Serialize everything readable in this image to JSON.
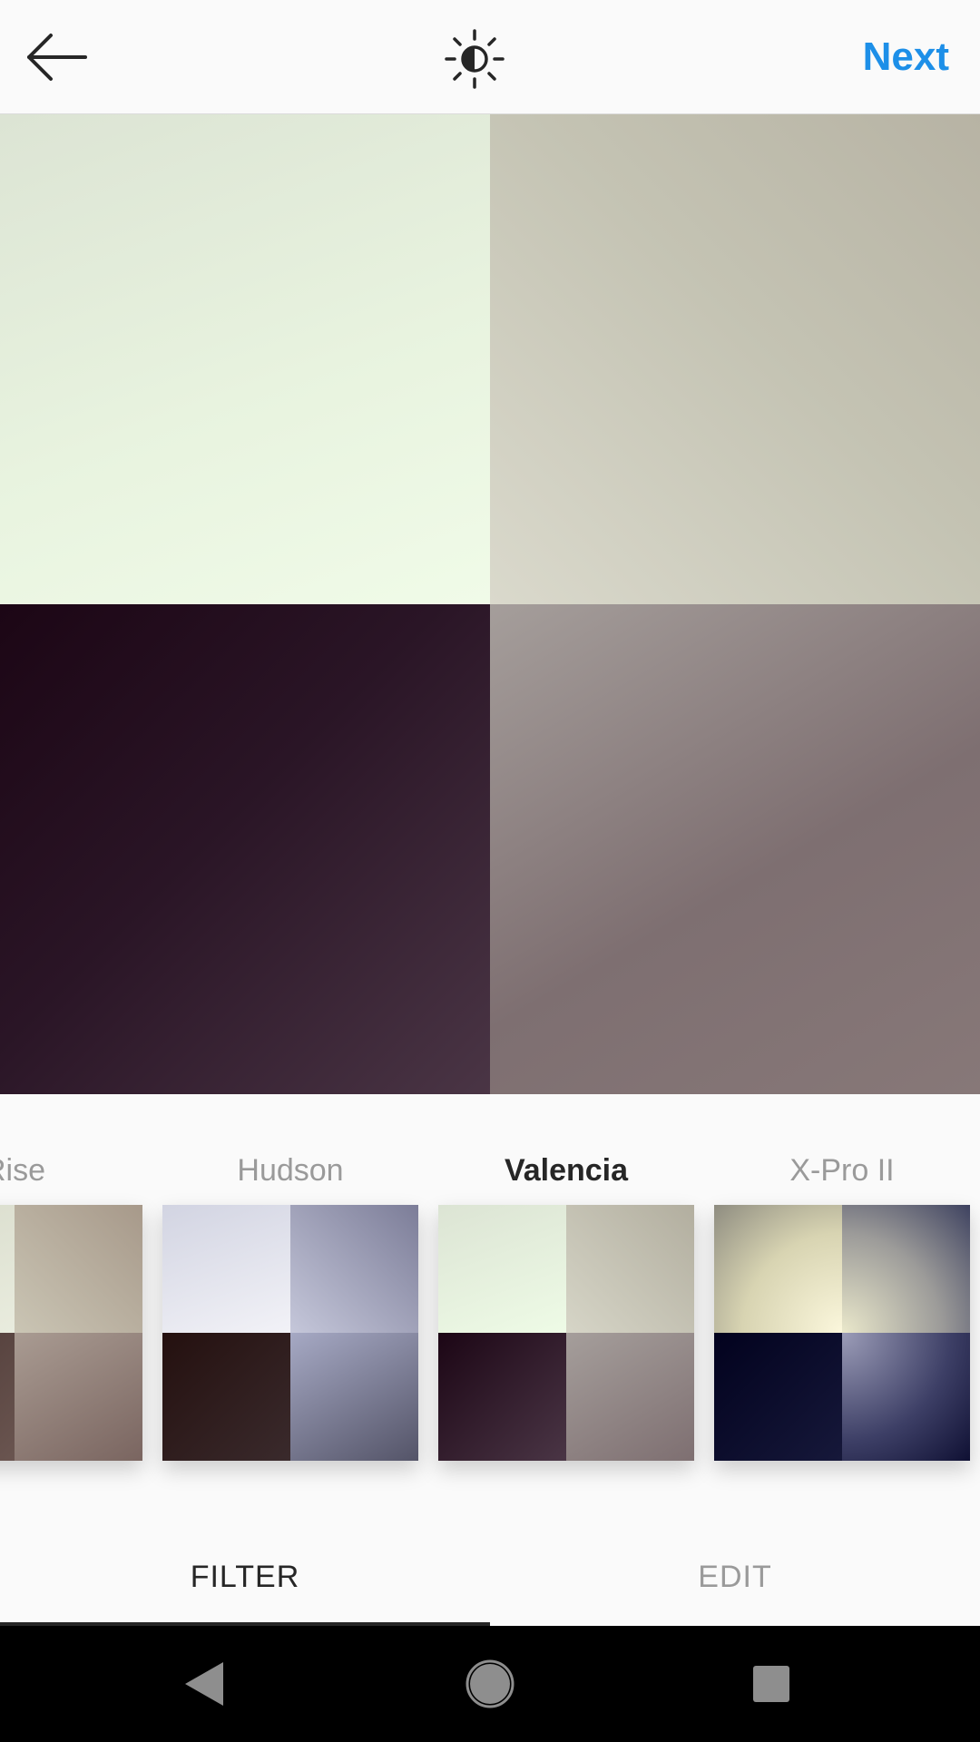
{
  "header": {
    "next_label": "Next",
    "back_icon": "arrow-left-icon",
    "lux_icon": "brightness-icon",
    "accent_color": "#1d8fe8"
  },
  "filters": [
    {
      "name": "Rise",
      "selected": false
    },
    {
      "name": "Hudson",
      "selected": false
    },
    {
      "name": "Valencia",
      "selected": true
    },
    {
      "name": "X-Pro II",
      "selected": false
    }
  ],
  "tabs": {
    "filter_label": "FILTER",
    "edit_label": "EDIT",
    "active": "FILTER"
  },
  "system_nav": {
    "back_icon": "nav-back-icon",
    "home_icon": "nav-home-icon",
    "recents_icon": "nav-recents-icon"
  }
}
